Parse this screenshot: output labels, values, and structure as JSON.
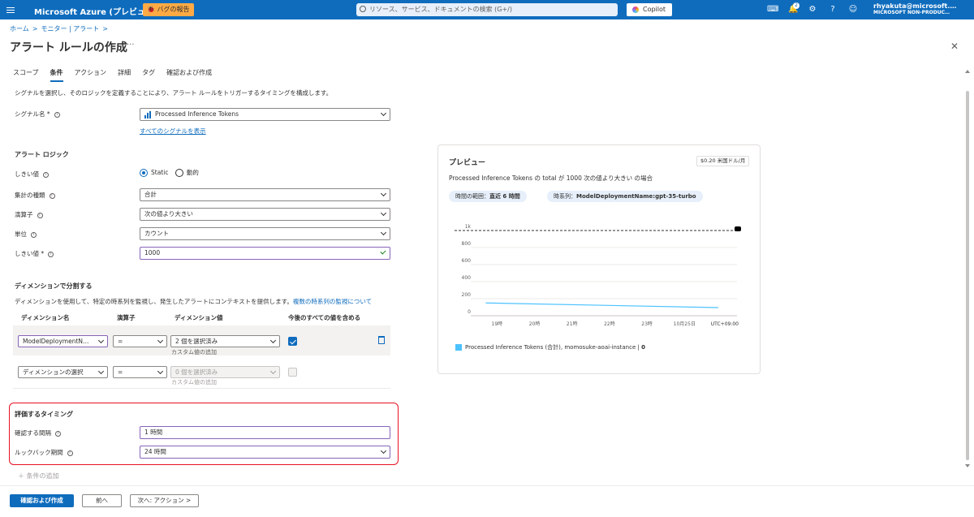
{
  "topbar": {
    "title": "Microsoft Azure (プレビュー)",
    "bug_label": "バグの報告",
    "search_placeholder": "リソース、サービス、ドキュメントの検索 (G+/)",
    "copilot_label": "Copilot",
    "notification_count": "2",
    "user_name": "rhyakuta@microsoft.…",
    "user_tenant": "MICROSOFT NON-PRODUC…"
  },
  "breadcrumb": [
    "ホーム",
    ">",
    "モニター | アラート",
    ">"
  ],
  "page_title": "アラート ルールの作成",
  "title_more": "···",
  "tabs": [
    "スコープ",
    "条件",
    "アクション",
    "詳細",
    "タグ",
    "確認および作成"
  ],
  "active_tab": "条件",
  "description": "シグナルを選択し、そのロジックを定義することにより、アラート ルールをトリガーするタイミングを構成します。",
  "signal": {
    "label": "シグナル名 *",
    "value": "Processed Inference Tokens",
    "link": "すべてのシグナルを表示"
  },
  "alert_logic": {
    "heading": "アラート ロジック",
    "threshold_label": "しきい値",
    "threshold_static": "Static",
    "threshold_dynamic": "動的",
    "aggregation_label": "集計の種類",
    "aggregation_value": "合計",
    "operator_label": "演算子",
    "operator_value": "次の値より大きい",
    "unit_label": "単位",
    "unit_value": "カウント",
    "threshold_value_label": "しきい値 *",
    "threshold_value": "1000"
  },
  "dimensions": {
    "heading": "ディメンションで分割する",
    "desc": "ディメンションを使用して、特定の時系列を監視し、発生したアラートにコンテキストを提供します。",
    "desc_link": "複数の時系列の監視について",
    "col_name": "ディメンション名",
    "col_operator": "演算子",
    "col_value": "ディメンション値",
    "col_include": "今後のすべての値を含める",
    "row1": {
      "name": "ModelDeploymentN…",
      "operator": "=",
      "value": "2 個を選択済み",
      "custom": "カスタム値の追加"
    },
    "row2": {
      "name": "ディメンションの選択",
      "operator": "=",
      "value": "0 個を選択済み",
      "custom": "カスタム値の追加"
    }
  },
  "timing": {
    "heading": "評価するタイミング",
    "check_label": "確認する間隔",
    "check_value": "1 時間",
    "lookback_label": "ルックバック期間",
    "lookback_value": "24 時間"
  },
  "add_condition": "条件の追加",
  "buttons": {
    "review": "確認および作成",
    "prev": "前へ",
    "next": "次へ: アクション >"
  },
  "preview": {
    "title": "プレビュー",
    "price": "$0.20 米国ドル/月",
    "desc": "Processed Inference Tokens の total が 1000 次の値より大きい の場合",
    "pill_range_label": "時間の範囲：",
    "pill_range_value": "直近 6 時間",
    "pill_series_label": "時系列：",
    "pill_series_value": "ModelDeploymentName:gpt-35-turbo",
    "legend": "Processed Inference Tokens (合計), momosuke-aoai-instance",
    "legend_value": "0"
  },
  "chart_data": {
    "type": "line",
    "x": [
      "19時",
      "20時",
      "21時",
      "22時",
      "23時",
      "10月25日"
    ],
    "x_suffix": "UTC+09:00",
    "ytick_labels": [
      "0",
      "200",
      "400",
      "600",
      "800",
      "1k"
    ],
    "ylim": [
      0,
      1000
    ],
    "threshold": 1000,
    "series": [
      {
        "name": "Processed Inference Tokens (合計), momosuke-aoai-instance",
        "color": "#4cc2ff",
        "x": [
          18.7,
          24.9
        ],
        "values": [
          150,
          95
        ]
      }
    ],
    "grid": true
  }
}
